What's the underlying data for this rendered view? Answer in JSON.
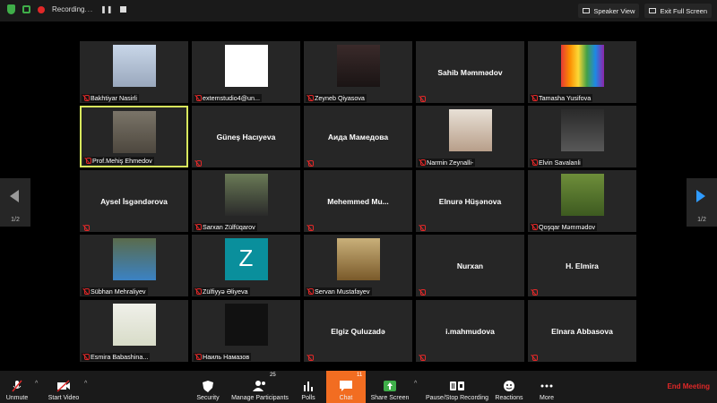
{
  "topbar": {
    "recording_label": "Recording",
    "recording_dots": "...",
    "pause_glyph": "❚❚",
    "speaker_view_label": "Speaker View",
    "exit_fullscreen_label": "Exit Full Screen"
  },
  "participants": [
    {
      "name": "Bakhtiyar Nasirli",
      "video": true
    },
    {
      "name": "extemstudio4@un...",
      "video": true
    },
    {
      "name": "Zeyneb Qiyasova",
      "video": true
    },
    {
      "name": "",
      "big_name": "Sahib Məmmədov",
      "video": false
    },
    {
      "name": "Tamasha Yusifova",
      "video": true
    },
    {
      "name": "Prof.Mehiş Ehmedov",
      "video": true,
      "active": true
    },
    {
      "name": "",
      "big_name": "Güneş Hacıyeva",
      "video": false
    },
    {
      "name": "",
      "big_name": "Аида Мамедова",
      "video": false
    },
    {
      "name": "Narmin Zeynalli-",
      "video": true
    },
    {
      "name": "Elvin Savalanli",
      "video": true
    },
    {
      "name": "",
      "big_name": "Aysel İsgəndərova",
      "video": false
    },
    {
      "name": "Sarxan Zülfüqarov",
      "video": true
    },
    {
      "name": "",
      "big_name": "Mehemmed Mu...",
      "video": false
    },
    {
      "name": "",
      "big_name": "Elnurə Hüşənova",
      "video": false
    },
    {
      "name": "Qoşqar Məmmədov",
      "video": true
    },
    {
      "name": "Sübhan Mehraliyev",
      "video": true
    },
    {
      "name": "Zülfiyyə Əliyeva",
      "video": true,
      "initial": "Z"
    },
    {
      "name": "Servan Mustafayev",
      "video": true
    },
    {
      "name": "",
      "big_name": "Nurxan",
      "video": false
    },
    {
      "name": "",
      "big_name": "H. Elmira",
      "video": false
    },
    {
      "name": "Esmira Babashina...",
      "video": true
    },
    {
      "name": "Наиль Намазов",
      "video": true
    },
    {
      "name": "",
      "big_name": "Elgiz Quluzadə",
      "video": false
    },
    {
      "name": "",
      "big_name": "i.mahmudova",
      "video": false
    },
    {
      "name": "",
      "big_name": "Elnara Abbasova",
      "video": false
    }
  ],
  "pagination": {
    "left": "1/2",
    "right": "1/2"
  },
  "toolbar": {
    "unmute": "Unmute",
    "start_video": "Start Video",
    "security": "Security",
    "manage_participants": "Manage Participants",
    "participant_count": "25",
    "polls": "Polls",
    "chat": "Chat",
    "chat_count": "11",
    "share_screen": "Share Screen",
    "pause_stop_recording": "Pause/Stop Recording",
    "reactions": "Reactions",
    "more": "More",
    "end_meeting": "End Meeting",
    "caret_glyph": "^"
  },
  "colors": {
    "active_speaker_border": "#d8e85d",
    "chat_button": "#f26d21",
    "end_meeting": "#e02828",
    "share_screen": "#3fae49",
    "next_arrow": "#2f9bff"
  }
}
